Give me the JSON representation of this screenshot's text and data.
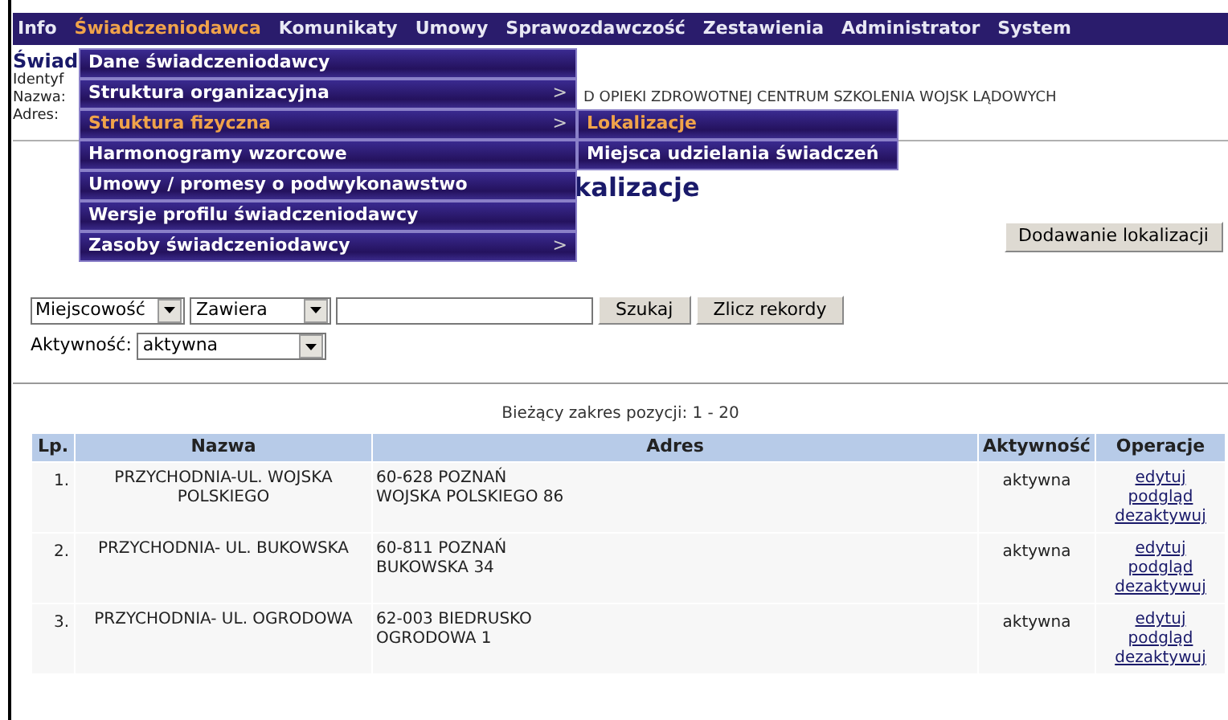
{
  "menu_bar": [
    {
      "label": "Info",
      "selected": false
    },
    {
      "label": "Świadczeniodawca",
      "selected": true
    },
    {
      "label": "Komunikaty",
      "selected": false
    },
    {
      "label": "Umowy",
      "selected": false
    },
    {
      "label": "Sprawozdawczość",
      "selected": false
    },
    {
      "label": "Zestawienia",
      "selected": false
    },
    {
      "label": "Administrator",
      "selected": false
    },
    {
      "label": "System",
      "selected": false
    }
  ],
  "dropdown": [
    {
      "label": "Dane świadczeniodawcy",
      "selected": false
    },
    {
      "label": "Struktura organizacyjna",
      "selected": false,
      "arrow": ">"
    },
    {
      "label": "Struktura fizyczna",
      "selected": true,
      "arrow": ">"
    },
    {
      "label": "Harmonogramy wzorcowe",
      "selected": false
    },
    {
      "label": "Umowy / promesy o podwykonawstwo",
      "selected": false
    },
    {
      "label": "Wersje profilu świadczeniodawcy",
      "selected": false
    },
    {
      "label": "Zasoby świadczeniodawcy",
      "selected": false,
      "arrow": ">"
    }
  ],
  "submenu": [
    {
      "label": "Lokalizacje",
      "selected": true
    },
    {
      "label": "Miejsca udzielania świadczeń",
      "selected": false
    }
  ],
  "header": {
    "title": "Świad",
    "labels": [
      "Identyf",
      "Nazwa:",
      "Adres:"
    ],
    "name_value": "D OPIEKI ZDROWOTNEJ CENTRUM SZKOLENIA WOJSK LĄDOWYCH"
  },
  "page_heading": "kalizacje",
  "add_button": "Dodawanie lokalizacji",
  "filters": {
    "field": "Miejscowość",
    "operator": "Zawiera",
    "search_button": "Szukaj",
    "count_button": "Zlicz rekordy",
    "activity_label": "Aktywność:",
    "activity": "aktywna"
  },
  "range_text": "Bieżący zakres pozycji: 1 - 20",
  "table": {
    "columns": [
      "Lp.",
      "Nazwa",
      "Adres",
      "Aktywność",
      "Operacje"
    ],
    "rows": [
      {
        "lp": "1.",
        "name": "PRZYCHODNIA-UL. WOJSKA POLSKIEGO",
        "address": [
          "60-628 POZNAŃ",
          "WOJSKA POLSKIEGO 86"
        ],
        "status": "aktywna",
        "actions": [
          "edytuj",
          "podgląd",
          "dezaktywuj"
        ]
      },
      {
        "lp": "2.",
        "name": "PRZYCHODNIA- UL. BUKOWSKA",
        "address": [
          "60-811 POZNAŃ",
          "BUKOWSKA 34"
        ],
        "status": "aktywna",
        "actions": [
          "edytuj",
          "podgląd",
          "dezaktywuj"
        ]
      },
      {
        "lp": "3.",
        "name": "PRZYCHODNIA- UL. OGRODOWA",
        "address": [
          "62-003 BIEDRUSKO",
          "OGRODOWA 1"
        ],
        "status": "aktywna",
        "actions": [
          "edytuj",
          "podgląd",
          "dezaktywuj"
        ]
      }
    ]
  }
}
